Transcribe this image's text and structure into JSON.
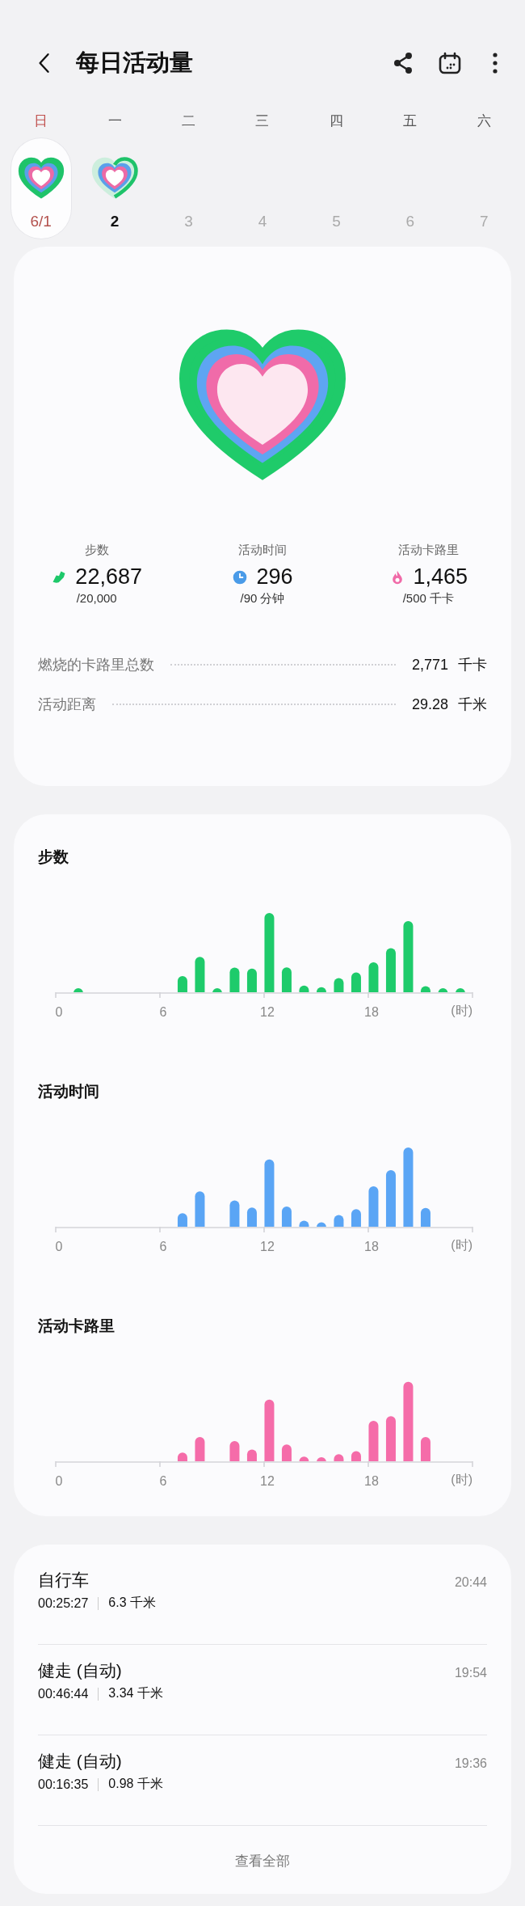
{
  "header": {
    "title": "每日活动量"
  },
  "week": [
    {
      "weekday": "日",
      "date": "6/1",
      "holiday": true,
      "selected": true,
      "kind": "complete"
    },
    {
      "weekday": "一",
      "date": "2",
      "holiday": false,
      "selected": false,
      "kind": "partial"
    },
    {
      "weekday": "二",
      "date": "3",
      "holiday": false,
      "selected": false,
      "kind": "future"
    },
    {
      "weekday": "三",
      "date": "4",
      "holiday": false,
      "selected": false,
      "kind": "future"
    },
    {
      "weekday": "四",
      "date": "5",
      "holiday": false,
      "selected": false,
      "kind": "future"
    },
    {
      "weekday": "五",
      "date": "6",
      "holiday": false,
      "selected": false,
      "kind": "future"
    },
    {
      "weekday": "六",
      "date": "7",
      "holiday": false,
      "selected": false,
      "kind": "future"
    }
  ],
  "stats": [
    {
      "kind": "steps",
      "label": "步数",
      "value": "22,687",
      "goal": "/20,000",
      "color": "#1ec86a"
    },
    {
      "kind": "time",
      "label": "活动时间",
      "value": "296",
      "goal": "/90 分钟",
      "color": "#4a9be8"
    },
    {
      "kind": "calories",
      "label": "活动卡路里",
      "value": "1,465",
      "goal": "/500 千卡",
      "color": "#f06aa8"
    }
  ],
  "totals": [
    {
      "label": "燃烧的卡路里总数",
      "value": "2,771",
      "unit": "千卡"
    },
    {
      "label": "活动距离",
      "value": "29.28",
      "unit": "千米"
    }
  ],
  "charts": [
    {
      "title": "步数",
      "color": "#1ecb6b",
      "ticks": [
        "0",
        "6",
        "12",
        "18"
      ],
      "unit": "(时)"
    },
    {
      "title": "活动时间",
      "color": "#5aa5f5",
      "ticks": [
        "0",
        "6",
        "12",
        "18"
      ],
      "unit": "(时)"
    },
    {
      "title": "活动卡路里",
      "color": "#f56ca9",
      "ticks": [
        "0",
        "6",
        "12",
        "18"
      ],
      "unit": "(时)"
    }
  ],
  "activities": [
    {
      "name": "自行车",
      "duration": "00:25:27",
      "distance": "6.3 千米",
      "time": "20:44"
    },
    {
      "name": "健走 (自动)",
      "duration": "00:46:44",
      "distance": "3.34 千米",
      "time": "19:54"
    },
    {
      "name": "健走 (自动)",
      "duration": "00:16:35",
      "distance": "0.98 千米",
      "time": "19:36"
    }
  ],
  "view_all": "查看全部"
}
